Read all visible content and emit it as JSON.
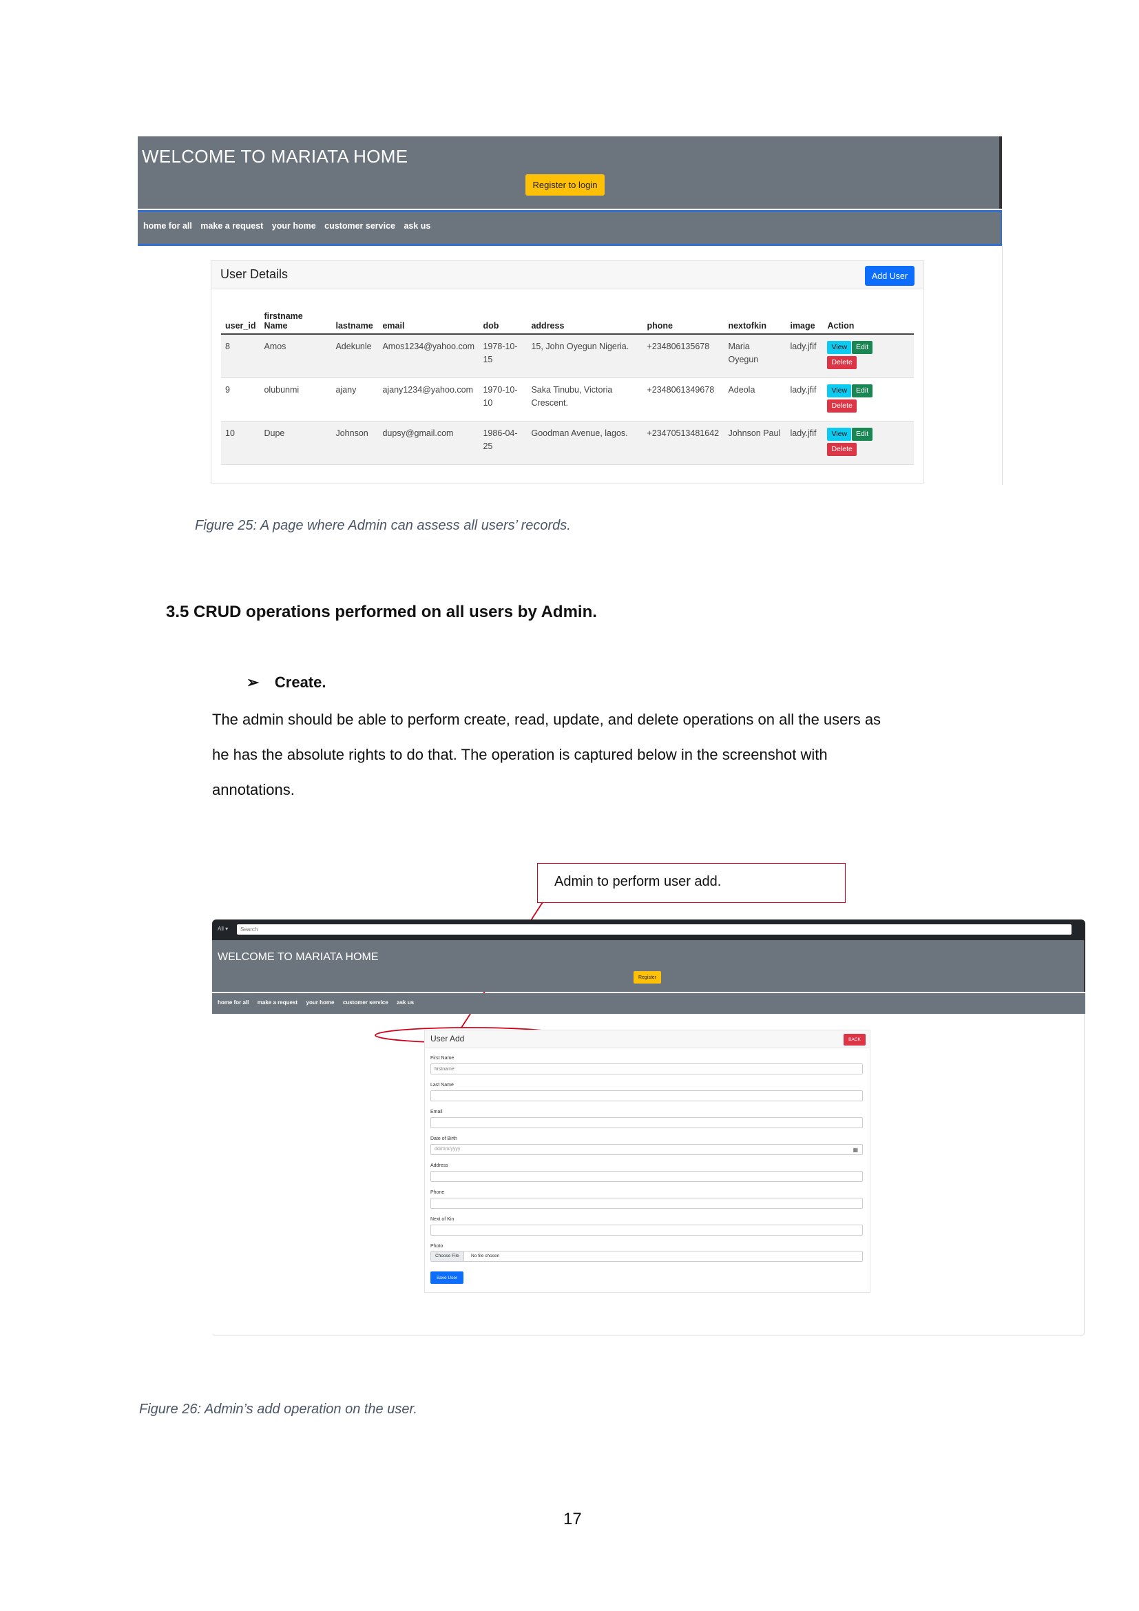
{
  "figure1": {
    "header_title": "WELCOME TO MARIATA HOME",
    "register_button": "Register to login",
    "nav": [
      "home for all",
      "make a request",
      "your home",
      "customer service",
      "ask us"
    ],
    "card_title": "User Details",
    "add_user_button": "Add User",
    "columns": {
      "user_id": "user_id",
      "firstname_top": "firstname",
      "firstname_bottom": "Name",
      "lastname": "lastname",
      "email": "email",
      "dob": "dob",
      "address": "address",
      "phone": "phone",
      "nextofkin": "nextofkin",
      "image": "image",
      "action": "Action"
    },
    "rows": [
      {
        "user_id": "8",
        "firstname": "Amos",
        "lastname": "Adekunle",
        "email": "Amos1234@yahoo.com",
        "dob_1": "1978-10-",
        "dob_2": "15",
        "address_1": "15, John Oyegun Nigeria.",
        "address_2": "",
        "phone": "+234806135678",
        "nextofkin_1": "Maria",
        "nextofkin_2": "Oyegun",
        "image": "lady.jfif"
      },
      {
        "user_id": "9",
        "firstname": "olubunmi",
        "lastname": "ajany",
        "email": "ajany1234@yahoo.com",
        "dob_1": "1970-10-",
        "dob_2": "10",
        "address_1": "Saka Tinubu, Victoria",
        "address_2": "Crescent.",
        "phone": "+2348061349678",
        "nextofkin_1": "Adeola",
        "nextofkin_2": "",
        "image": "lady.jfif"
      },
      {
        "user_id": "10",
        "firstname": "Dupe",
        "lastname": "Johnson",
        "email": "dupsy@gmail.com",
        "dob_1": "1986-04-",
        "dob_2": "25",
        "address_1": "Goodman Avenue, lagos.",
        "address_2": "",
        "phone": "+23470513481642",
        "nextofkin_1": "Johnson Paul",
        "nextofkin_2": "",
        "image": "lady.jfif"
      }
    ],
    "actions": {
      "view": "View",
      "edit": "Edit",
      "delete": "Delete"
    },
    "caption": "Figure 25: A page where Admin can assess all users’ records."
  },
  "section": {
    "heading": "3.5 CRUD operations performed on all users by Admin.",
    "bullet_marker": "➢",
    "bullet": "Create.",
    "paragraph_lines": [
      "The admin should be able to perform create, read, update, and delete operations on all the users as",
      "he has the absolute rights to do that. The operation is captured below in the screenshot with",
      "annotations."
    ]
  },
  "annotation": "Admin to perform user add.",
  "figure2": {
    "search_scope": "All ▾",
    "search_placeholder": "Search",
    "header_title": "WELCOME TO MARIATA HOME",
    "register_button": "Register",
    "nav": [
      "home for all",
      "make a request",
      "your home",
      "customer service",
      "ask us"
    ],
    "card_title": "User Add",
    "back_button": "BACK",
    "fields": [
      {
        "label": "First Name",
        "placeholder": "firstname"
      },
      {
        "label": "Last Name",
        "placeholder": ""
      },
      {
        "label": "Email",
        "placeholder": ""
      },
      {
        "label": "Date of Birth",
        "placeholder": "dd/mm/yyyy"
      },
      {
        "label": "Address",
        "placeholder": ""
      },
      {
        "label": "Phone",
        "placeholder": ""
      },
      {
        "label": "Next of Kin",
        "placeholder": ""
      }
    ],
    "photo_label": "Photo",
    "choose_file": "Choose File",
    "no_file": "No file chosen",
    "save_button": "Save User",
    "caption": "Figure 26: Admin’s add operation on the user."
  },
  "page_number": "17",
  "colors": {
    "header_gray": "#6c757d",
    "warning_yellow": "#ffc107",
    "primary_blue": "#0d6efd",
    "info_cyan": "#0dcaf0",
    "success_green": "#198754",
    "danger_red": "#dc3545",
    "annotation_red": "#d0021b"
  }
}
